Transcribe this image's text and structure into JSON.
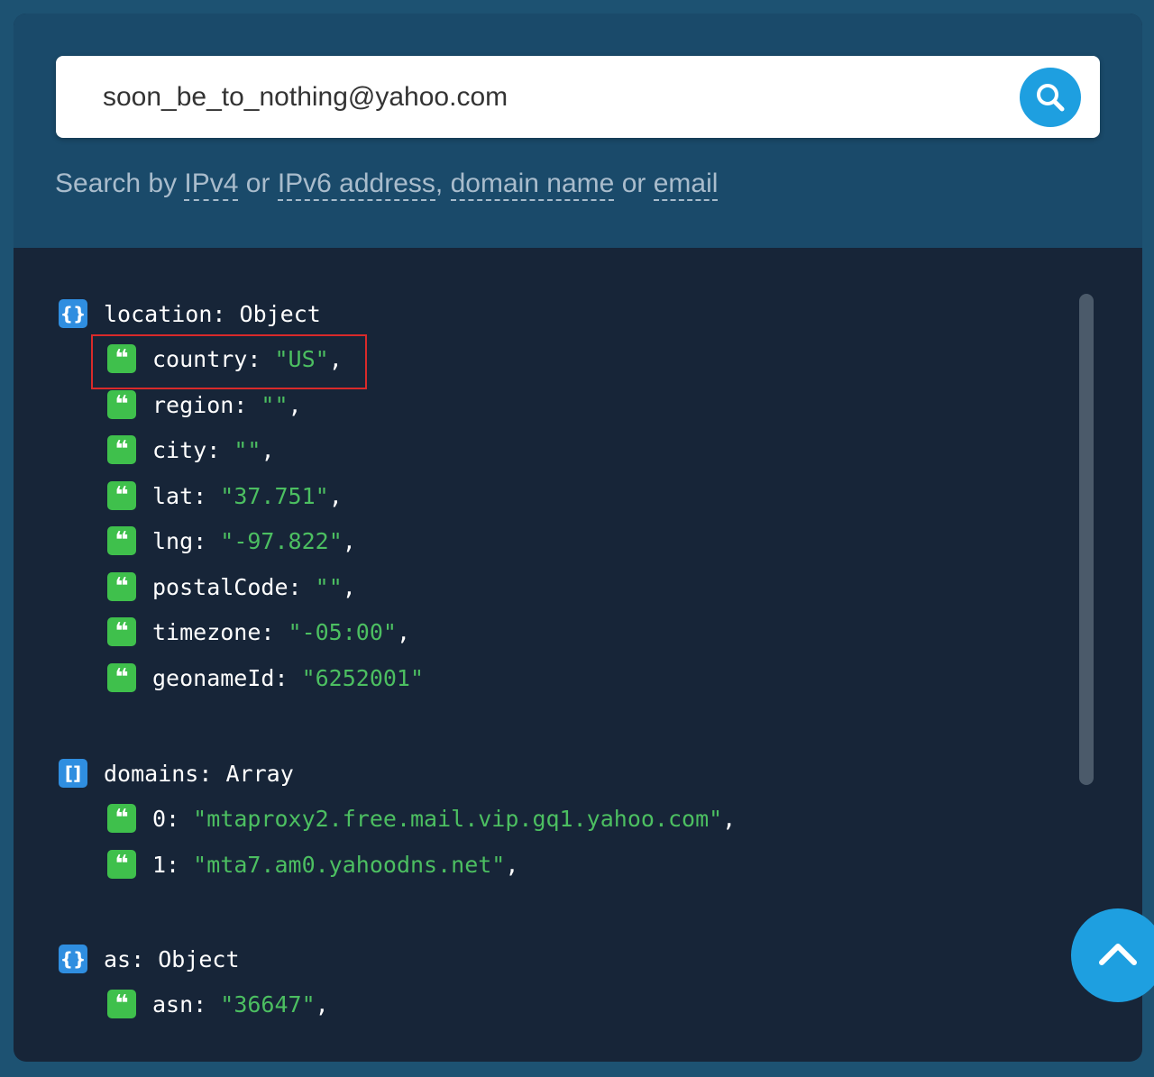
{
  "search": {
    "value": "soon_be_to_nothing@yahoo.com",
    "button_icon": "search-icon"
  },
  "hint": {
    "prefix": "Search by ",
    "link_ipv4": "IPv4",
    "or1": " or ",
    "link_ipv6": "IPv6 address",
    "comma": ", ",
    "link_domain": "domain name",
    "or2": " or ",
    "link_email": "email"
  },
  "tree": {
    "location": {
      "key": "location:",
      "type": "Object",
      "fields": [
        {
          "key": "country:",
          "value": "\"US\"",
          "sep": ","
        },
        {
          "key": "region:",
          "value": "\"\"",
          "sep": ","
        },
        {
          "key": "city:",
          "value": "\"\"",
          "sep": ","
        },
        {
          "key": "lat:",
          "value": "\"37.751\"",
          "sep": ","
        },
        {
          "key": "lng:",
          "value": "\"-97.822\"",
          "sep": ","
        },
        {
          "key": "postalCode:",
          "value": "\"\"",
          "sep": ","
        },
        {
          "key": "timezone:",
          "value": "\"-05:00\"",
          "sep": ","
        },
        {
          "key": "geonameId:",
          "value": "\"6252001\"",
          "sep": ""
        }
      ]
    },
    "domains": {
      "key": "domains:",
      "type": "Array",
      "items": [
        {
          "key": "0:",
          "value": "\"mtaproxy2.free.mail.vip.gq1.yahoo.com\"",
          "sep": ","
        },
        {
          "key": "1:",
          "value": "\"mta7.am0.yahoodns.net\"",
          "sep": ","
        }
      ]
    },
    "as": {
      "key": "as:",
      "type": "Object",
      "fields": [
        {
          "key": "asn:",
          "value": "\"36647\"",
          "sep": ","
        }
      ]
    }
  },
  "icons": {
    "object": "curly-braces-icon",
    "array": "square-brackets-icon",
    "string": "quote-icon"
  },
  "colors": {
    "accent": "#1e9fe0",
    "string_value": "#4cbf61",
    "highlight_border": "#d92a2a"
  }
}
